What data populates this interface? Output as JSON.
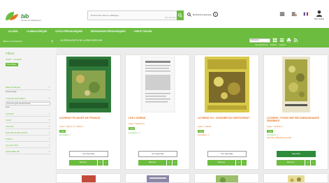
{
  "header": {
    "logo_text": "bib",
    "logo_sub": "Réseau des bibliothèques",
    "search_placeholder": "Rechercher dans le catalogue",
    "search_sub": "Tous les documents",
    "advanced_search": "Recherche avancée",
    "account_label": "Mon compte"
  },
  "nav": {
    "items": [
      "Accueil",
      "La bibliothèque",
      "Outils pédagogiques",
      "Ressources pédagogiques",
      "Voir et savoir"
    ]
  },
  "sidebar": {
    "top_label": "Affiner ma recherche",
    "filters_title": "Filtres",
    "current_filter": "Sujet : Lichens",
    "current_pill": "Tout effacer",
    "facets": [
      {
        "label": "Bibliothèque",
        "toggle": "+"
      },
      {
        "label": "Type de document",
        "toggle": "+"
      },
      {
        "label": "Auteur",
        "toggle": "+"
      },
      {
        "label": "Sujet",
        "toggle": "+"
      },
      {
        "label": "Langue",
        "toggle": "+"
      },
      {
        "label": "Date de publication",
        "toggle": "+"
      },
      {
        "label": "Public",
        "toggle": "+"
      },
      {
        "label": "Collection",
        "toggle": "+"
      },
      {
        "label": "Disponibilité",
        "toggle": "+"
      }
    ],
    "site_label": "Bibliothèque",
    "site_value": "Tous les sites",
    "type_select": "Tous les types de documents",
    "type_value": "Livre"
  },
  "results": {
    "title": "15 résultats de la recherche",
    "sort_label": "Pertinence",
    "select_all": "Tout sélectionner",
    "export": "Exporter",
    "print": "Imprimer"
  },
  "cards": [
    {
      "title": "Lichens foliacés de France",
      "author": "Auteur : Dupont, M. ; Martin, L.",
      "badge": "Livre",
      "status": "Exemplaires : 1",
      "status2": "",
      "availability": "Non disponible",
      "available": false,
      "reserve": "Réserver"
    },
    {
      "title": "Les lichens",
      "author": "Auteur : Bertrand, P.",
      "badge": "Livre",
      "status": "Exemplaires : 2",
      "status2": "",
      "availability": "Non disponible",
      "available": false,
      "reserve": "Réserver"
    },
    {
      "title": "Lichens GO : dossier du participant",
      "author": "Auteur : Collectif",
      "badge": "Livre",
      "status": "",
      "status2": "Exemplaires : 1",
      "availability": "Non disponible",
      "available": false,
      "reserve": "Réserver"
    },
    {
      "title": "Lichens : pour une reconnaissance sensible",
      "author": "Auteur : Gauthier, A.",
      "badge": "Livre",
      "status": "Exemplaires : 1",
      "status2": "Disponible : Bibliothèque centrale",
      "availability": "Disponible",
      "available": true,
      "reserve": "Réserver"
    }
  ],
  "colors": {
    "brand_green": "#6cbd3f",
    "dark_green": "#2e8b3a",
    "accent_orange": "#e8731f"
  }
}
